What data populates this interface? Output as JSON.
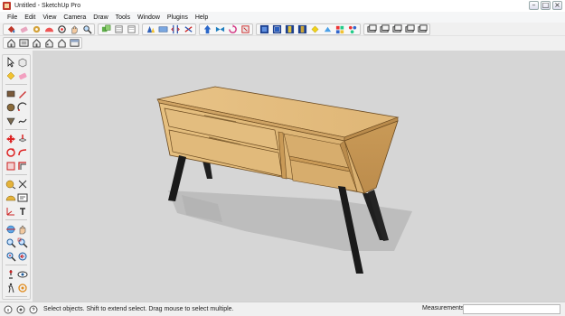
{
  "window": {
    "title": "Untitled - SketchUp Pro",
    "controls": [
      "minimize",
      "maximize",
      "close"
    ]
  },
  "menu": [
    "File",
    "Edit",
    "View",
    "Camera",
    "Draw",
    "Tools",
    "Window",
    "Plugins",
    "Help"
  ],
  "status": {
    "help_text": "Select objects. Shift to extend select. Drag mouse to select multiple.",
    "measurements_label": "Measurements",
    "measurements_value": ""
  },
  "colors": {
    "viewport_bg": "#d6d6d6",
    "wood": "#e2ba7c",
    "legs": "#1c1c1c"
  },
  "icons": {
    "toolbar1": [
      "paint-bucket-icon",
      "eraser-icon",
      "tape-icon",
      "protractor-icon",
      "orbit-icon",
      "pan-icon",
      "zoom-icon",
      "components-icon",
      "layer-icon",
      "materials-icon",
      "styles-icon",
      "text-icon",
      "dimension-icon",
      "section-icon",
      "push-pull-icon",
      "move-icon",
      "rotate-icon",
      "scale-icon",
      "follow-me-icon",
      "offset-icon",
      "intersect-icon",
      "xray-icon",
      "wireframe-icon",
      "hidden-line-icon",
      "shaded-icon",
      "textured-icon",
      "monochrome-icon",
      "shadows-icon",
      "fog-icon",
      "camera-icon",
      "view-top-icon",
      "view-front-icon",
      "view-right-icon",
      "view-back-icon",
      "view-left-icon"
    ],
    "toolbar2": [
      "iso-view-icon",
      "top-view-icon",
      "front-view-icon",
      "right-view-icon",
      "back-view-icon",
      "left-view-icon"
    ]
  }
}
